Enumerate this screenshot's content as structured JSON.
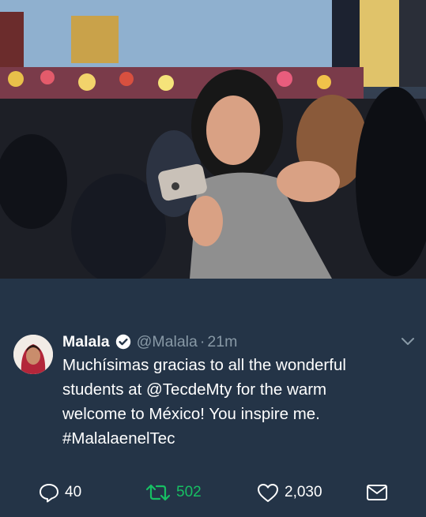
{
  "photo": {
    "description_icon": "photo-image"
  },
  "tweet": {
    "author_name": "Malala",
    "author_handle": "@Malala",
    "separator": "·",
    "time": "21m",
    "text_lines": [
      "Muchísimas gracias to all the wonderful",
      "students at @TecdeMty for the warm",
      "welcome to México! You inspire me.",
      "#MalalaenelTec"
    ]
  },
  "actions": {
    "replies": "40",
    "retweets": "502",
    "likes": "2,030"
  },
  "colors": {
    "background": "#243447",
    "secondary_text": "#8899a6",
    "retweet_green": "#17bf63",
    "verified_badge": "#ffffff"
  }
}
